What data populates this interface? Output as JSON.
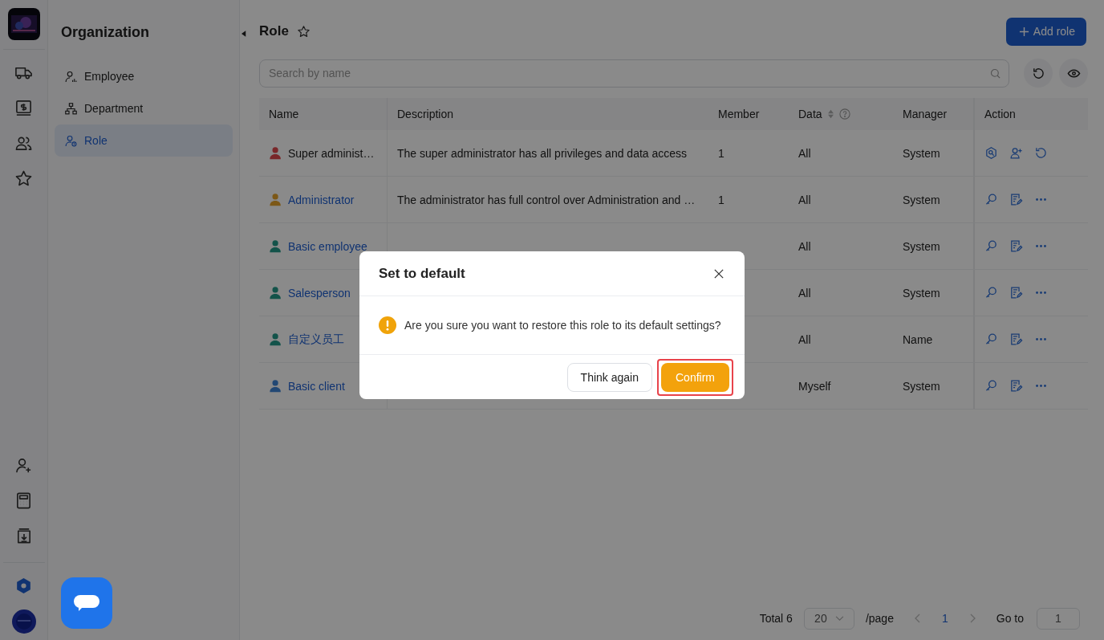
{
  "rail": {
    "items": [
      {
        "selected": false
      },
      {
        "selected": false
      },
      {
        "selected": false
      },
      {
        "selected": false
      },
      {
        "selected": false
      },
      {
        "selected": false
      },
      {
        "selected": false
      },
      {
        "selected": true
      }
    ]
  },
  "sidebar": {
    "title": "Organization",
    "items": [
      {
        "label": "Employee",
        "selected": false
      },
      {
        "label": "Department",
        "selected": false
      },
      {
        "label": "Role",
        "selected": true
      }
    ]
  },
  "header": {
    "title": "Role",
    "add_button": "Add role"
  },
  "search": {
    "placeholder": "Search by name"
  },
  "table": {
    "columns": [
      "Name",
      "Description",
      "Member",
      "Data",
      "Manager",
      "Action"
    ],
    "rows": [
      {
        "name": "Super administ…",
        "link": false,
        "color": "#792729",
        "kind": "builtin",
        "description": "The super administrator has all privileges and data access",
        "member": "1",
        "data": "All",
        "manager": "System"
      },
      {
        "name": "Administrator",
        "link": true,
        "color": "#7c5817",
        "kind": "editable",
        "description": "The administrator has full control over Administration and …",
        "member": "1",
        "data": "All",
        "manager": "System"
      },
      {
        "name": "Basic employee",
        "link": true,
        "color": "#13534a",
        "kind": "editable",
        "data": "All",
        "manager": "System"
      },
      {
        "name": "Salesperson",
        "link": true,
        "color": "#13534a",
        "kind": "editable",
        "data": "All",
        "manager": "System"
      },
      {
        "name": "自定义员工",
        "link": true,
        "color": "#13534a",
        "kind": "editable",
        "data": "All",
        "manager": "Name"
      },
      {
        "name": "Basic client",
        "link": true,
        "color": "#224874",
        "kind": "editable",
        "data": "Myself",
        "manager": "System"
      }
    ]
  },
  "pagination": {
    "total": "Total 6",
    "page_size": "20",
    "per_page": "/page",
    "current": "1",
    "goto_label": "Go to",
    "goto_value": "1"
  },
  "dialog": {
    "title": "Set to default",
    "message": "Are you sure you want to restore this role to its default settings?",
    "cancel": "Think again",
    "confirm": "Confirm",
    "confirm_highlighted": true
  }
}
